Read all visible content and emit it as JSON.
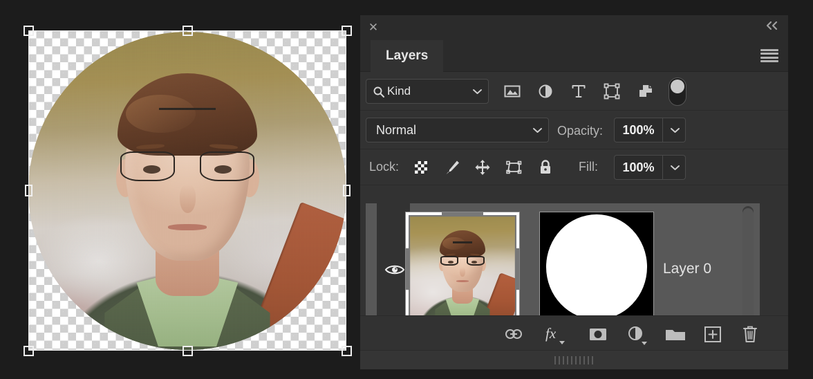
{
  "app": {
    "theme_bg": "#1c1c1c",
    "panel_bg": "#323232",
    "accent_text": "#e4e4e4"
  },
  "panel": {
    "close_label": "✕",
    "collapse_label": "«",
    "menu_icon": "hamburger-menu-icon",
    "tabs": [
      {
        "label": "Layers",
        "active": true
      }
    ]
  },
  "filter_row": {
    "kind_label": "Kind",
    "search_icon": "search-icon",
    "dropdown_icon": "chevron-down-icon",
    "filter_icons": [
      {
        "name": "pixel-layers-filter-icon",
        "title": "Filter for pixel layers"
      },
      {
        "name": "adjustment-layers-filter-icon",
        "title": "Filter for adjustment layers"
      },
      {
        "name": "type-layers-filter-icon",
        "title": "Filter for type layers"
      },
      {
        "name": "shape-layers-filter-icon",
        "title": "Filter for shape layers"
      },
      {
        "name": "smart-object-filter-icon",
        "title": "Filter for smart objects"
      }
    ],
    "toggle": {
      "name": "filter-enable-toggle",
      "state": "off"
    }
  },
  "blend_row": {
    "blend_mode": "Normal",
    "opacity_label": "Opacity:",
    "opacity_value": "100%",
    "dropdown_icon": "chevron-down-icon"
  },
  "lock_row": {
    "lock_label": "Lock:",
    "lock_icons": [
      {
        "name": "lock-transparent-pixels-icon"
      },
      {
        "name": "lock-image-pixels-icon"
      },
      {
        "name": "lock-position-icon"
      },
      {
        "name": "lock-artboard-nesting-icon"
      },
      {
        "name": "lock-all-icon"
      }
    ],
    "fill_label": "Fill:",
    "fill_value": "100%"
  },
  "layers": [
    {
      "name": "Layer 0",
      "visible": true,
      "selected": true,
      "thumbnail": "portrait-photo-thumbnail",
      "mask_thumbnail": "circular-layer-mask-thumbnail"
    }
  ],
  "layer_toolbar": {
    "buttons": [
      {
        "name": "link-layers-button",
        "icon": "link-icon"
      },
      {
        "name": "layer-style-button",
        "icon": "fx-icon",
        "label": "fx",
        "has_caret": true
      },
      {
        "name": "add-layer-mask-button",
        "icon": "mask-icon"
      },
      {
        "name": "new-adjustment-layer-button",
        "icon": "half-filled-circle-icon",
        "has_caret": true
      },
      {
        "name": "new-group-button",
        "icon": "folder-icon"
      },
      {
        "name": "new-layer-button",
        "icon": "plus-square-icon"
      },
      {
        "name": "delete-layer-button",
        "icon": "trash-icon"
      }
    ]
  },
  "canvas": {
    "document_name": "",
    "transparency_checker": true,
    "selection": {
      "active": true,
      "handle_count": 8,
      "handle_color": "#f0f0f0"
    },
    "content": "circular-masked-portrait-photo"
  },
  "footer": {
    "grip": "panel-resize-grip"
  }
}
